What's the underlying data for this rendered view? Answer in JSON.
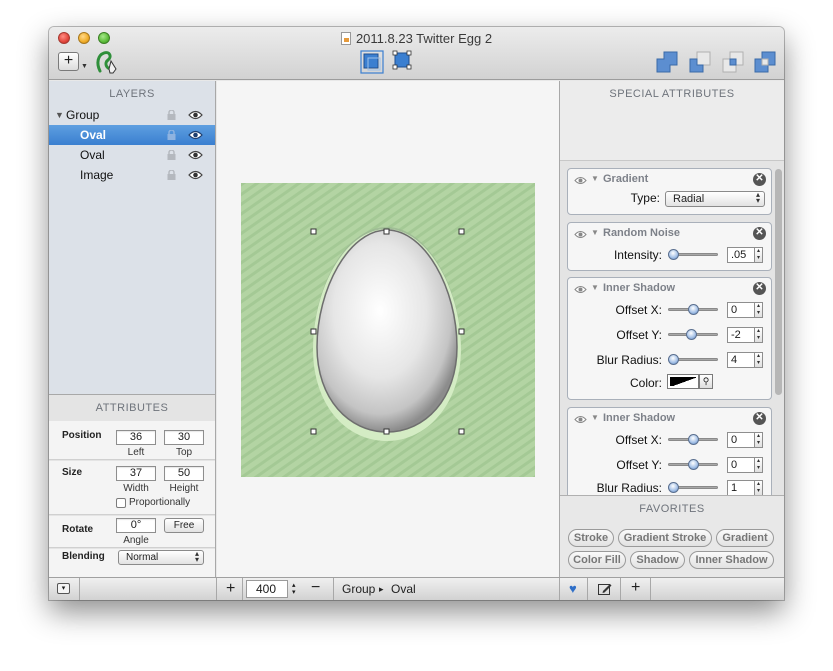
{
  "window": {
    "title": "2011.8.23 Twitter Egg 2"
  },
  "toolbar": {
    "add_label": "+"
  },
  "layers": {
    "header": "LAYERS",
    "items": [
      {
        "label": "Group",
        "selected": false
      },
      {
        "label": "Oval",
        "selected": true
      },
      {
        "label": "Oval",
        "selected": false
      },
      {
        "label": "Image",
        "selected": false
      }
    ]
  },
  "attributes": {
    "header": "ATTRIBUTES",
    "position_label": "Position",
    "left_value": "36",
    "top_value": "30",
    "left_caption": "Left",
    "top_caption": "Top",
    "size_label": "Size",
    "width_value": "37",
    "height_value": "50",
    "width_caption": "Width",
    "height_caption": "Height",
    "proportionally_label": "Proportionally",
    "rotate_label": "Rotate",
    "angle_value": "0°",
    "angle_caption": "Angle",
    "free_label": "Free",
    "blending_label": "Blending",
    "blending_value": "Normal"
  },
  "canvas": {
    "background_color": "#b3d4a3",
    "egg_color": "#ececec"
  },
  "bottom_bar": {
    "zoom_value": "400",
    "breadcrumb_group": "Group",
    "breadcrumb_sep": "▸",
    "breadcrumb_oval": "Oval"
  },
  "special": {
    "header": "SPECIAL ATTRIBUTES",
    "gradient": {
      "title": "Gradient",
      "type_label": "Type:",
      "type_value": "Radial"
    },
    "noise": {
      "title": "Random Noise",
      "intensity_label": "Intensity:",
      "intensity_value": ".05",
      "intensity_level": 0.05
    },
    "inner_shadow_1": {
      "title": "Inner Shadow",
      "offset_x_label": "Offset X:",
      "offset_x_value": "0",
      "offset_y_label": "Offset Y:",
      "offset_y_value": "-2",
      "blur_label": "Blur Radius:",
      "blur_value": "4",
      "color_label": "Color:"
    },
    "inner_shadow_2": {
      "title": "Inner Shadow",
      "offset_x_label": "Offset X:",
      "offset_x_value": "0",
      "offset_y_label": "Offset Y:",
      "offset_y_value": "0",
      "blur_label": "Blur Radius:",
      "blur_value": "1"
    }
  },
  "favorites": {
    "header": "FAVORITES",
    "items": [
      "Stroke",
      "Gradient Stroke",
      "Gradient",
      "Color Fill",
      "Shadow",
      "Inner Shadow"
    ]
  }
}
